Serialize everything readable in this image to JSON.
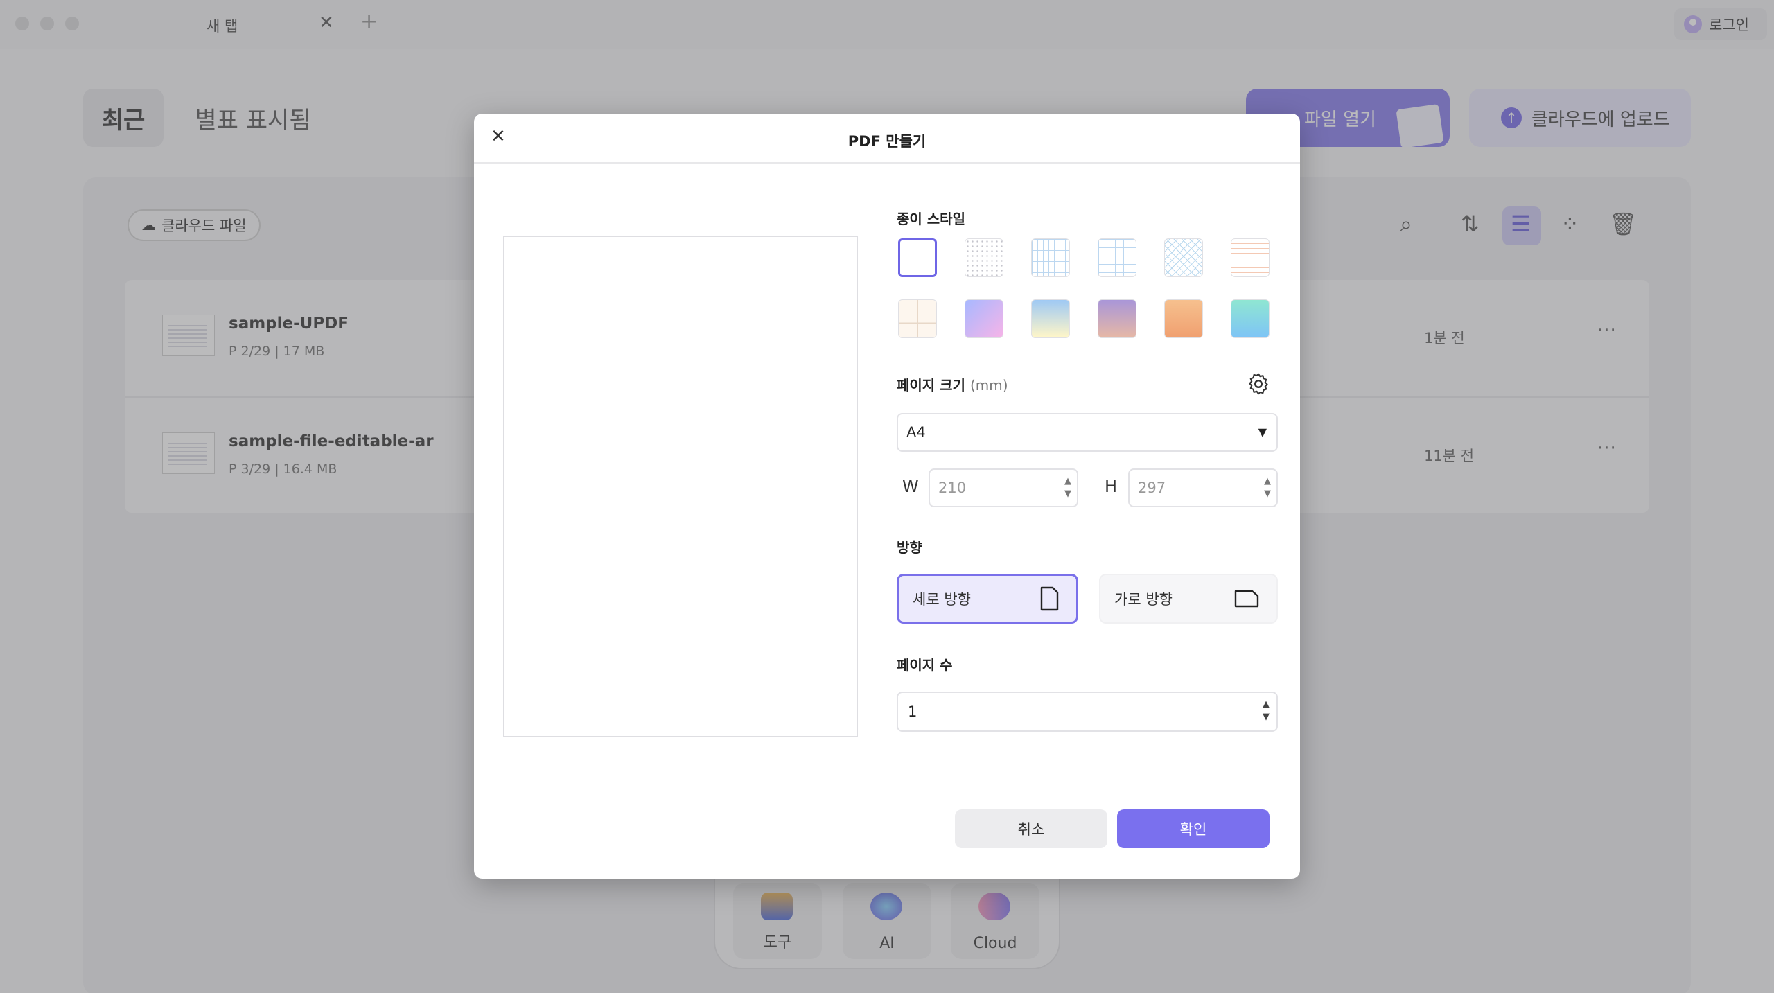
{
  "titlebar": {
    "tab_title": "새 탭",
    "tab_close": "✕",
    "new_tab": "+",
    "login_label": "로그인"
  },
  "home": {
    "segments": [
      "최근",
      "별표 표시됨"
    ],
    "open_file_label": "파일 열기",
    "upload_label": "클라우드에 업로드",
    "cloud_filter_label": "클라우드 파일",
    "files": [
      {
        "name": "sample-UPDF",
        "meta": "P 2/29 | 17 MB",
        "time": "1분 전",
        "more": "···"
      },
      {
        "name": "sample-file-editable-ar",
        "meta": "P 3/29 | 16.4 MB",
        "time": "11분 전",
        "more": "···"
      }
    ]
  },
  "dock": {
    "items": [
      {
        "label": "도구"
      },
      {
        "label": "AI"
      },
      {
        "label": "Cloud"
      }
    ]
  },
  "modal": {
    "title": "PDF 만들기",
    "close": "✕",
    "paper_style_label": "종이 스타일",
    "page_size_label": "페이지 크기",
    "page_size_unit": "(mm)",
    "page_size_value": "A4",
    "width_label": "W",
    "width_value": "210",
    "height_label": "H",
    "height_value": "297",
    "orientation_label": "방향",
    "portrait_label": "세로 방향",
    "landscape_label": "가로 방향",
    "page_count_label": "페이지 수",
    "page_count_value": "1",
    "cancel_label": "취소",
    "confirm_label": "확인"
  },
  "colors": {
    "accent": "#7a70ee",
    "selected_border": "#6f66e6"
  }
}
